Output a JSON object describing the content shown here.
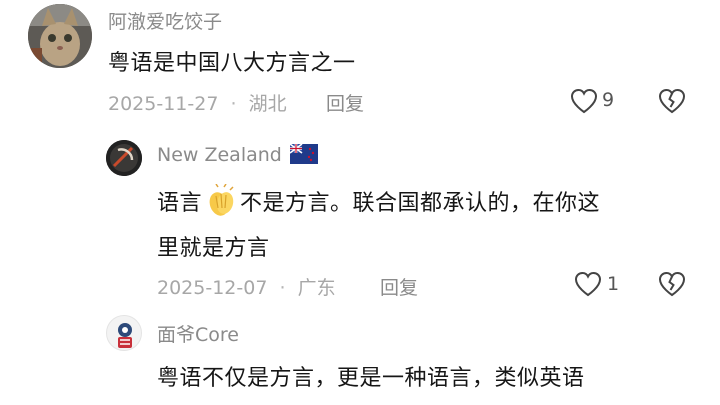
{
  "comments": [
    {
      "username": "阿澈爱吃饺子",
      "text_lines": [
        "粤语是中国八大方言之一"
      ],
      "date": "2025-11-27",
      "separator": "·",
      "location": "湖北",
      "reply_label": "回复",
      "like_count": "9"
    },
    {
      "username": "New Zealand",
      "flag": "new-zealand-flag",
      "text_line1_a": "语言",
      "emoji": "clapping-hands",
      "text_line1_b": "不是方言。联合国都承认的，在你这",
      "text_line2": "里就是方言",
      "date": "2025-12-07",
      "separator": "·",
      "location": "广东",
      "reply_label": "回复",
      "like_count": "1"
    },
    {
      "username": "面爷Core",
      "text_lines": [
        "粤语不仅是方言，更是一种语言，类似英语"
      ]
    }
  ],
  "colors": {
    "username": "#8a8a8a",
    "text": "#161616",
    "meta": "#a7a7a7"
  }
}
